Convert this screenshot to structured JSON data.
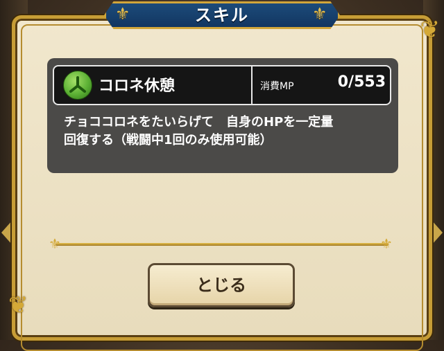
{
  "dialog": {
    "title": "スキル"
  },
  "skill": {
    "name": "コロネ休憩",
    "icon": "tri-branch-icon",
    "mp_label": "消費MP",
    "mp_value": "0/553",
    "description": "チョココロネをたいらげて　自身のHPを一定量\n回復する（戦闘中1回のみ使用可能）"
  },
  "buttons": {
    "close_label": "とじる"
  },
  "colors": {
    "title_plate": "#1c4b7a",
    "gold_border": "#c79d36",
    "parchment": "#f1e7cd",
    "skill_panel": "#4b4a48",
    "skill_icon_green": "#5bb034"
  }
}
